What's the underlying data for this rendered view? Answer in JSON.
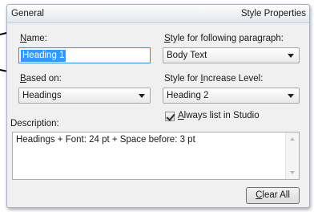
{
  "header": {
    "left_title": "General",
    "right_title": "Style Properties"
  },
  "name": {
    "label_hotkey": "N",
    "label_rest": "ame:",
    "value": "Heading 1"
  },
  "style_following": {
    "label_hotkey": "S",
    "label_rest": "tyle for following paragraph:",
    "value": "Body Text"
  },
  "based_on": {
    "label_hotkey": "B",
    "label_rest": "ased on:",
    "value": "Headings"
  },
  "style_increase": {
    "label_pre": "Style for ",
    "label_hotkey": "I",
    "label_rest": "ncrease Level:",
    "value": "Heading 2"
  },
  "always_list": {
    "checked": true,
    "label_hotkey": "A",
    "label_rest": "lways list in Studio"
  },
  "description": {
    "label": "Description:",
    "text": "Headings + Font: 24 pt + Space before: 3 pt"
  },
  "clear_all": {
    "label_hotkey": "C",
    "label_rest": "lear All"
  }
}
